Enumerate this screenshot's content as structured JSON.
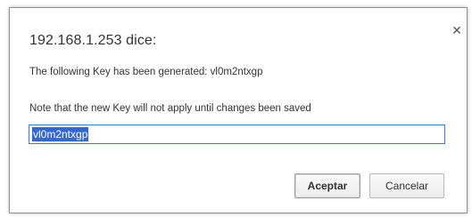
{
  "dialog": {
    "title": "192.168.1.253 dice:",
    "message_key": "The following Key has been generated: vl0m2ntxgp",
    "message_note": "Note that the new Key will not apply until changes been saved",
    "input_value": "vl0m2ntxgp",
    "close_icon": "close-icon",
    "accept_label": "Aceptar",
    "cancel_label": "Cancelar"
  },
  "colors": {
    "input_focus_border": "#3b7be0",
    "selection": "#3168d6"
  }
}
